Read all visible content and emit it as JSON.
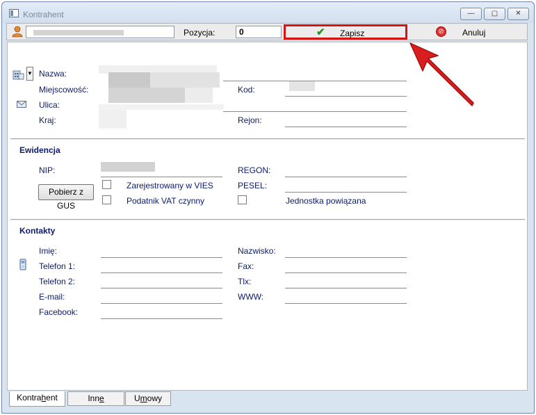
{
  "window": {
    "title": "Kontrahent",
    "minimize": "—",
    "restore": "▢",
    "close": "✕"
  },
  "toolbar": {
    "position_label": "Pozycja:",
    "position_value": "0",
    "save_label": "Zapisz",
    "cancel_label": "Anuluj"
  },
  "address": {
    "name_label": "Nazwa:",
    "city_label": "Miejscowość:",
    "street_label": "Ulica:",
    "country_label": "Kraj:",
    "postcode_label": "Kod:",
    "region_label": "Rejon:"
  },
  "ewidencja": {
    "title": "Ewidencja",
    "nip_label": "NIP:",
    "regon_label": "REGON:",
    "pesel_label": "PESEL:",
    "gus_button": "Pobierz z GUS",
    "vies_label": "Zarejestrowany w VIES",
    "vat_label": "Podatnik VAT czynny",
    "related_label": "Jednostka powiązana"
  },
  "kontakty": {
    "title": "Kontakty",
    "first_name_label": "Imię:",
    "phone1_label": "Telefon 1:",
    "phone2_label": "Telefon 2:",
    "email_label": "E-mail:",
    "facebook_label": "Facebook:",
    "last_name_label": "Nazwisko:",
    "fax_label": "Fax:",
    "tlx_label": "Tlx:",
    "www_label": "WWW:"
  },
  "tabs": [
    {
      "label_pre": "Kontra",
      "label_u": "h",
      "label_post": "ent"
    },
    {
      "label_pre": "Inn",
      "label_u": "e",
      "label_post": ""
    },
    {
      "label_pre": "U",
      "label_u": "m",
      "label_post": "owy"
    }
  ],
  "colors": {
    "accent_red": "#d41515",
    "label_blue": "#0b1a6b",
    "check_green": "#1e9a1e"
  },
  "icons": [
    "user-icon",
    "check-icon",
    "cancel-icon",
    "building-icon",
    "envelope-icon",
    "phone-icon",
    "arrow-annotation-icon"
  ]
}
